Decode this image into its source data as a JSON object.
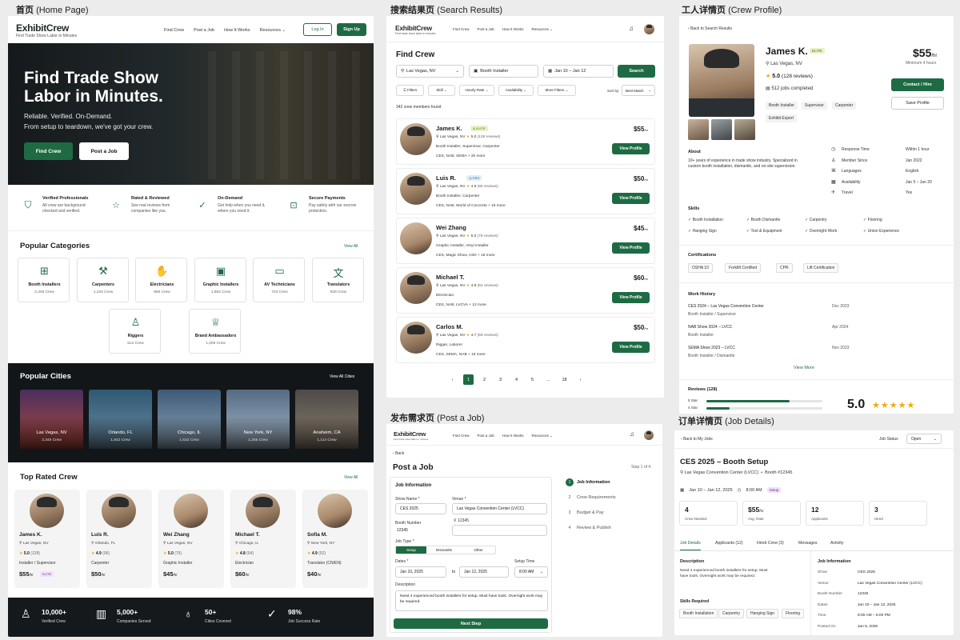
{
  "titles": {
    "home": "首页",
    "home_en": "(Home Page)",
    "search": "搜索结果页",
    "search_en": "(Search Results)",
    "profile": "工人详情页",
    "profile_en": "(Crew Profile)",
    "post": "发布需求页",
    "post_en": "(Post a Job)",
    "job": "订单详情页",
    "job_en": "(Job Details)"
  },
  "brand": {
    "name": "ExhibitCrew",
    "tagline": "Find Trade Show Labor in Minutes",
    "tagline_small": "Find trade show labor in minutes"
  },
  "nav": {
    "find": "Find Crew",
    "post": "Post a Job",
    "how": "How It Works",
    "resources": "Resources",
    "login": "Log In",
    "signup": "Sign Up"
  },
  "home": {
    "hero_title": "Find Trade Show Labor in Minutes.",
    "hero_sub1": "Reliable. Verified. On-Demand.",
    "hero_sub2": "From setup to teardown, we've got your crew.",
    "btn_find": "Find Crew",
    "btn_post": "Post a Job",
    "features": [
      {
        "title": "Verified Professionals",
        "text": "All crew are background checked and verified."
      },
      {
        "title": "Rated & Reviewed",
        "text": "See real reviews from companies like you."
      },
      {
        "title": "On-Demand",
        "text": "Get help when you need it, where you need it."
      },
      {
        "title": "Secure Payments",
        "text": "Pay safely with our escrow protection."
      }
    ],
    "categories_title": "Popular Categories",
    "view_all": "View All",
    "categories": [
      {
        "name": "Booth Installers",
        "count": "2,345 Crew"
      },
      {
        "name": "Carpenters",
        "count": "1,234 Crew"
      },
      {
        "name": "Electricians",
        "count": "856 Crew"
      },
      {
        "name": "Graphic Installers",
        "count": "1,582 Crew"
      },
      {
        "name": "AV Technicians",
        "count": "743 Crew"
      },
      {
        "name": "Translators",
        "count": "628 Crew"
      },
      {
        "name": "Riggers",
        "count": "512 Crew"
      },
      {
        "name": "Brand Ambassadors",
        "count": "1,206 Crew"
      }
    ],
    "cities_title": "Popular Cities",
    "view_all_cities": "View All Cities",
    "cities": [
      {
        "name": "Las Vegas, NV",
        "count": "2,345 Crew"
      },
      {
        "name": "Orlando, FL",
        "count": "1,842 Crew"
      },
      {
        "name": "Chicago, IL",
        "count": "1,532 Crew"
      },
      {
        "name": "New York, NY",
        "count": "1,256 Crew"
      },
      {
        "name": "Anaheim, CA",
        "count": "1,114 Crew"
      }
    ],
    "top_title": "Top Rated Crew",
    "top": [
      {
        "name": "James K.",
        "loc": "Las Vegas, NV",
        "rating": "5.0",
        "reviews": "(128)",
        "role": "Installer / Supervisor",
        "rate": "$55",
        "unit": "/hr",
        "badge": "ELITE"
      },
      {
        "name": "Luis R.",
        "loc": "Orlando, FL",
        "rating": "4.9",
        "reviews": "(96)",
        "role": "Carpenter",
        "rate": "$50",
        "unit": "/hr",
        "badge": ""
      },
      {
        "name": "Wei Zhang",
        "loc": "Las Vegas, NV",
        "rating": "5.0",
        "reviews": "(75)",
        "role": "Graphic Installer",
        "rate": "$45",
        "unit": "/hr",
        "badge": ""
      },
      {
        "name": "Michael T.",
        "loc": "Chicago, IL",
        "rating": "4.8",
        "reviews": "(64)",
        "role": "Electrician",
        "rate": "$60",
        "unit": "/hr",
        "badge": ""
      },
      {
        "name": "Sofia M.",
        "loc": "New York, NY",
        "rating": "4.9",
        "reviews": "(52)",
        "role": "Translator (CN/EN)",
        "rate": "$40",
        "unit": "/hr",
        "badge": ""
      }
    ],
    "stats": [
      {
        "value": "10,000+",
        "label": "Verified Crew"
      },
      {
        "value": "5,000+",
        "label": "Companies Served"
      },
      {
        "value": "50+",
        "label": "Cities Covered"
      },
      {
        "value": "98%",
        "label": "Job Success Rate"
      }
    ]
  },
  "search": {
    "title": "Find Crew",
    "loc": "Las Vegas, NV",
    "role": "Booth Installer",
    "dates": "Jan 10 – Jan 12",
    "btn": "Search",
    "filters": [
      "Filters",
      "Skill",
      "Hourly Rate",
      "Availability",
      "More Filters"
    ],
    "sort_label": "Sort by:",
    "sort_value": "Best Match",
    "count": "342 crew members found",
    "results": [
      {
        "name": "James K.",
        "badge": "ELITE",
        "loc": "Las Vegas, NV",
        "rating": "5.0",
        "reviews": "(128 reviews)",
        "skills": "Booth Installer, Supervisor, Carpenter",
        "shows": "CES, NAB, SEMA + 20 more",
        "rate": "$55",
        "unit": "/hr"
      },
      {
        "name": "Luis R.",
        "badge": "PRO",
        "loc": "Las Vegas, NV",
        "rating": "4.9",
        "reviews": "(96 reviews)",
        "skills": "Booth Installer, Carpenter",
        "shows": "CES, NAB, World of Concrete + 15 more",
        "rate": "$50",
        "unit": "/hr"
      },
      {
        "name": "Wei Zhang",
        "badge": "",
        "loc": "Las Vegas, NV",
        "rating": "5.0",
        "reviews": "(75 reviews)",
        "skills": "Graphic Installer, Vinyl Installer",
        "shows": "CES, Magic Show, ASD + 18 more",
        "rate": "$45",
        "unit": "/hr"
      },
      {
        "name": "Michael T.",
        "badge": "",
        "loc": "Las Vegas, NV",
        "rating": "4.8",
        "reviews": "(64 reviews)",
        "skills": "Electrician",
        "shows": "CES, NAB, LVCVA + 12 more",
        "rate": "$60",
        "unit": "/hr"
      },
      {
        "name": "Carlos M.",
        "badge": "",
        "loc": "Las Vegas, NV",
        "rating": "4.7",
        "reviews": "(59 reviews)",
        "skills": "Rigger, Laborer",
        "shows": "CES, SEMA, NAB + 16 more",
        "rate": "$50",
        "unit": "/hr"
      }
    ],
    "view_profile": "View Profile",
    "pages": [
      "‹",
      "1",
      "2",
      "3",
      "4",
      "5",
      "...",
      "18",
      "›"
    ]
  },
  "profile": {
    "back": "Back to Search Results",
    "name": "James K.",
    "badge": "ELITE",
    "loc": "Las Vegas, NV",
    "rating": "5.0",
    "reviews": "(128 reviews)",
    "jobs": "512 jobs completed",
    "rate": "$55",
    "unit": "/hr",
    "minimum": "Minimum 4 hours",
    "contact": "Contact / Hire",
    "save": "Save Profile",
    "tags": [
      "Booth Installer",
      "Supervisor",
      "Carpenter",
      "Exhibit Expert"
    ],
    "about_title": "About",
    "about": "10+ years of experience in trade show industry. Specialized in custom booth installation, dismantle, and on-site supervision.",
    "facts": [
      {
        "label": "Response Time",
        "value": "Within 1 hour"
      },
      {
        "label": "Member Since",
        "value": "Jan 2022"
      },
      {
        "label": "Languages",
        "value": "English"
      },
      {
        "label": "Availability",
        "value": "Jan 5 – Jan 20"
      },
      {
        "label": "Travel",
        "value": "Yes"
      }
    ],
    "skills_title": "Skills",
    "skills": [
      "Booth Installation",
      "Booth Dismantle",
      "Carpentry",
      "Flooring",
      "Hanging Sign",
      "Tool & Equipment",
      "Overnight Work",
      "Union Experience"
    ],
    "cert_title": "Certifications",
    "certs": [
      "OSHA 10",
      "Forklift Certified",
      "CPR",
      "Lift Certification"
    ],
    "work_title": "Work History",
    "work": [
      {
        "title": "CES 2024 – Las Vegas Convention Center",
        "role": "Booth Installer / Supervisor",
        "date": "Dec 2023"
      },
      {
        "title": "NAB Show 2024 – LVCC",
        "role": "Booth Installer",
        "date": "Apr 2024"
      },
      {
        "title": "SEMA Show 2023 – LVCC",
        "role": "Booth Installer / Dismantle",
        "date": "Nov 2023"
      }
    ],
    "view_more": "View More",
    "reviews_title": "Reviews (128)",
    "bar_labels": [
      "5 Star",
      "4 Star"
    ],
    "bar_values": [
      0.72,
      0.2
    ],
    "big_rating": "5.0",
    "stars": "★★★★★"
  },
  "post": {
    "back": "Back",
    "title": "Post a Job",
    "step": "Step 1 of 4",
    "section": "Job Information",
    "show_label": "Show Name *",
    "show": "CES 2025",
    "venue_label": "Venue *",
    "venue": "Las Vegas Convention Center (LVCC)",
    "venue_code": "12345",
    "booth_label": "Booth Number",
    "booth": "12345",
    "type_label": "Job Type *",
    "types": [
      "Setup",
      "Dismantle",
      "Other"
    ],
    "dates_label": "Dates *",
    "date_from": "Jan 10, 2025",
    "to": "to",
    "date_to": "Jan 12, 2025",
    "time_label": "Setup Time",
    "time": "8:00 AM",
    "desc_label": "Description",
    "desc": "Need 4 experienced booth installers for setup. Must have tools. Overnight work may be required.",
    "next": "Next Step",
    "steps": [
      {
        "num": "1",
        "label": "Job Information"
      },
      {
        "num": "2",
        "label": "Crew Requirements"
      },
      {
        "num": "3",
        "label": "Budget & Pay"
      },
      {
        "num": "4",
        "label": "Review & Publish"
      }
    ]
  },
  "job": {
    "back": "Back to My Jobs",
    "status_label": "Job Status",
    "status": "Open",
    "title": "CES 2025 – Booth Setup",
    "venue": "Las Vegas Convention Center (LVCC)",
    "booth": "Booth #12345",
    "dates": "Jan 10 – Jan 12, 2025",
    "time": "8:00 AM",
    "tag": "Setup",
    "stats": [
      {
        "value": "4",
        "label": "Crew Needed"
      },
      {
        "value": "$55",
        "unit": "/hr",
        "label": "Avg. Rate"
      },
      {
        "value": "12",
        "label": "Applicants"
      },
      {
        "value": "3",
        "label": "Hired"
      }
    ],
    "tabs": [
      "Job Details",
      "Applicants (12)",
      "Hired Crew (3)",
      "Messages",
      "Activity"
    ],
    "desc_title": "Description",
    "desc": "Need 4 experienced booth installers for setup. Must have tools. Overnight work may be required.",
    "skills_title": "Skills Required",
    "skills": [
      "Booth Installation",
      "Carpentry",
      "Hanging Sign",
      "Flooring"
    ],
    "info_title": "Job Information",
    "info": [
      {
        "label": "Show",
        "value": "CES 2025"
      },
      {
        "label": "Venue",
        "value": "Las Vegas Convention Center (LVCC)"
      },
      {
        "label": "Booth Number",
        "value": "12345"
      },
      {
        "label": "Dates",
        "value": "Jan 10 – Jan 12, 2025"
      },
      {
        "label": "Time",
        "value": "8:00 AM – 6:00 PM"
      },
      {
        "label": "Posted On",
        "value": "Jan 5, 2025"
      }
    ]
  },
  "colors": {
    "brand": "#1e6b43",
    "dark": "#15191c",
    "star": "#f2a90a"
  }
}
